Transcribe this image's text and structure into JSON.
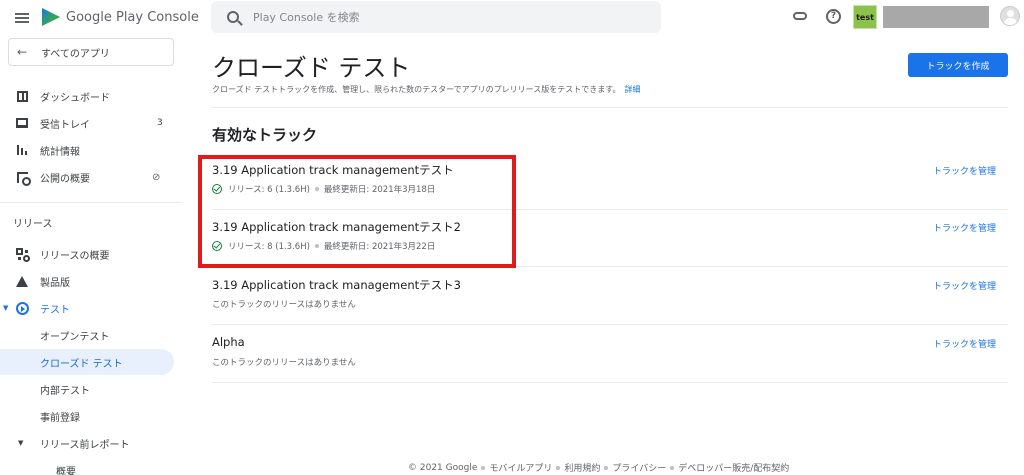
{
  "header": {
    "logo_text": "Google Play Console",
    "search_placeholder": "Play Console を検索",
    "app_icon_label": "test"
  },
  "sidebar": {
    "back_label": "すべてのアプリ",
    "items": [
      {
        "label": "ダッシュボード",
        "icon": "dashboard-icon"
      },
      {
        "label": "受信トレイ",
        "icon": "inbox-icon",
        "badge": "3"
      },
      {
        "label": "統計情報",
        "icon": "stats-icon"
      },
      {
        "label": "公開の概要",
        "icon": "publish-icon"
      }
    ],
    "release_section": "リリース",
    "release_items": [
      {
        "label": "リリースの概要",
        "icon": "grid-icon"
      },
      {
        "label": "製品版",
        "icon": "warning-icon"
      },
      {
        "label": "テスト",
        "icon": "test-icon"
      }
    ],
    "test_sub": [
      {
        "label": "オープンテスト"
      },
      {
        "label": "クローズド テスト"
      },
      {
        "label": "内部テスト"
      },
      {
        "label": "事前登録"
      }
    ],
    "prelaunch_label": "リリース前レポート",
    "prelaunch_sub": "概要"
  },
  "main": {
    "title": "クローズド テスト",
    "create_button": "トラックを作成",
    "description": "クローズド テストトラックを作成、管理し、限られた数のテスターでアプリのプレリリース版をテストできます。",
    "description_link": "詳細",
    "section_title": "有効なトラック",
    "manage_label": "トラックを管理",
    "tracks": [
      {
        "name": "3.19 Application track managementテスト",
        "release": "リリース: 6 (1.3.6H)",
        "updated": "最終更新日: 2021年3月18日"
      },
      {
        "name": "3.19 Application track managementテスト2",
        "release": "リリース: 8 (1.3.6H)",
        "updated": "最終更新日: 2021年3月22日"
      },
      {
        "name": "3.19 Application track managementテスト3",
        "empty": "このトラックのリリースはありません"
      },
      {
        "name": "Alpha",
        "empty": "このトラックのリリースはありません"
      }
    ]
  },
  "footer": {
    "copyright": "© 2021 Google",
    "links": [
      "モバイルアプリ",
      "利用規約",
      "プライバシー",
      "デベロッパー販売/配布契約"
    ]
  },
  "colors": {
    "accent": "#1a73e8",
    "highlight": "#e01b1b",
    "active_bg": "#e8f0fe"
  }
}
